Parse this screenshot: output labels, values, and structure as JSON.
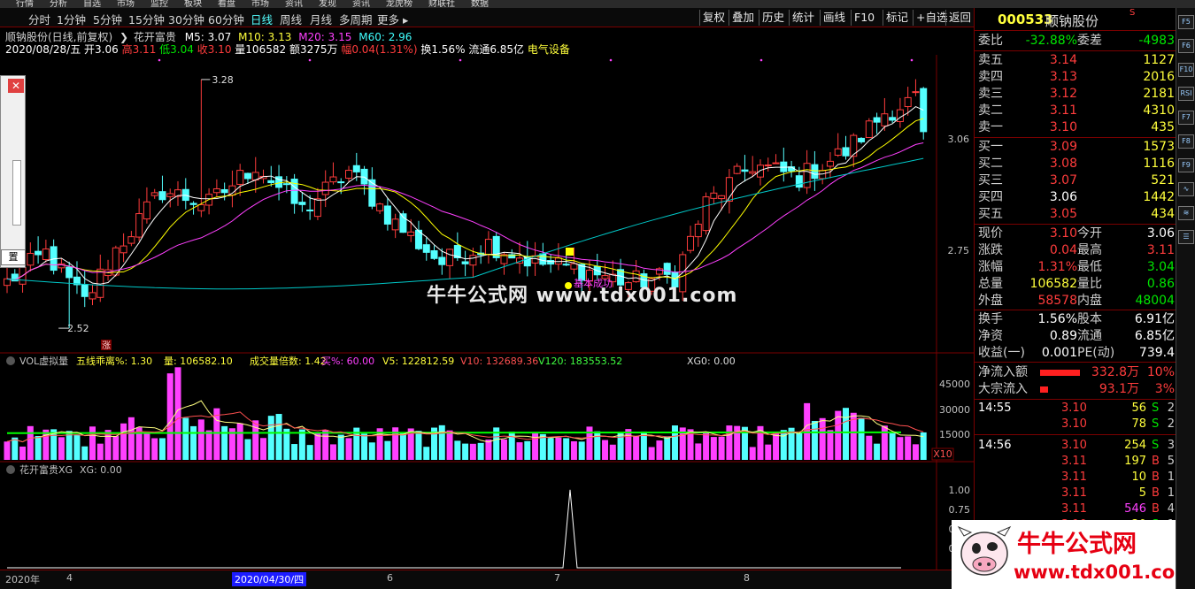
{
  "top_menu": [
    "行情",
    "分析",
    "自选",
    "市场",
    "监控",
    "板块",
    "看盘",
    "市场",
    "资讯",
    "发现",
    "资讯",
    "龙虎榜",
    "财联社",
    "数据"
  ],
  "toolbar": {
    "periods": [
      "分时",
      "1分钟",
      "5分钟",
      "15分钟",
      "30分钟",
      "60分钟",
      "日线",
      "周线",
      "月线",
      "多周期",
      "更多 ▸"
    ],
    "selected": "日线",
    "right_buttons": [
      "复权",
      "叠加",
      "历史",
      "统计",
      "画线",
      "F10",
      "标记",
      "+自选",
      "返回"
    ]
  },
  "chart_header": {
    "name": "顺钠股份(日线,前复权)",
    "indicator": "花开富贵",
    "m5": "M5: 3.07",
    "m10": "M10: 3.13",
    "m20": "M20: 3.15",
    "m60": "M60: 2.96",
    "date": "2020/08/28/五",
    "open": "开3.06",
    "high": "高3.11",
    "low": "低3.04",
    "close": "收3.10",
    "vol": "量106582",
    "amt": "额3275万",
    "chg": "幅0.04(1.31%)",
    "turn": "换1.56%",
    "float": "流通6.85亿",
    "sector": "电气设备"
  },
  "price_labels": {
    "high": "3.28",
    "low": "2.52",
    "mark": "涨",
    "success": "基本成功",
    "axis": [
      "3.06",
      "2.75"
    ]
  },
  "watermark": "牛牛公式网 www.tdx001.com",
  "vol_header": {
    "name": "VOL虚拟量",
    "wx": "五线乖离%: 1.30",
    "liang": "量: 106582.10",
    "bei": "成交量倍数: 1.42",
    "mai": "买%: 60.00",
    "v5": "V5: 122812.59",
    "v10": "V10: 132689.36",
    "v120": "V120: 183553.52",
    "xg0": "XG0: 0.00",
    "axis": [
      "45000",
      "30000",
      "15000"
    ],
    "x10": "X10"
  },
  "xg_header": {
    "name": "花开富贵XG",
    "val": "XG: 0.00",
    "axis": [
      "1.00",
      "0.75",
      "0.50",
      "0.25"
    ]
  },
  "x_axis": [
    "2020年",
    "4",
    "2020/04/30/四",
    "6",
    "7",
    "8"
  ],
  "stock": {
    "code": "000533",
    "name": "顺钠股份",
    "flag": "S"
  },
  "weibi": {
    "label": "委比",
    "value": "-32.88%",
    "label2": "委差",
    "value2": "-4983"
  },
  "asks": [
    {
      "label": "卖五",
      "price": "3.14",
      "vol": "1127"
    },
    {
      "label": "卖四",
      "price": "3.13",
      "vol": "2016"
    },
    {
      "label": "卖三",
      "price": "3.12",
      "vol": "2181"
    },
    {
      "label": "卖二",
      "price": "3.11",
      "vol": "4310"
    },
    {
      "label": "卖一",
      "price": "3.10",
      "vol": "435"
    }
  ],
  "bids": [
    {
      "label": "买一",
      "price": "3.09",
      "vol": "1573"
    },
    {
      "label": "买二",
      "price": "3.08",
      "vol": "1116"
    },
    {
      "label": "买三",
      "price": "3.07",
      "vol": "521"
    },
    {
      "label": "买四",
      "price": "3.06",
      "vol": "1442"
    },
    {
      "label": "买五",
      "price": "3.05",
      "vol": "434"
    }
  ],
  "quote": [
    {
      "l1": "现价",
      "v1": "3.10",
      "c1": "red",
      "l2": "今开",
      "v2": "3.06",
      "c2": "wht"
    },
    {
      "l1": "涨跌",
      "v1": "0.04",
      "c1": "red",
      "l2": "最高",
      "v2": "3.11",
      "c2": "red"
    },
    {
      "l1": "涨幅",
      "v1": "1.31%",
      "c1": "red",
      "l2": "最低",
      "v2": "3.04",
      "c2": "grn"
    },
    {
      "l1": "总量",
      "v1": "106582",
      "c1": "yel",
      "l2": "量比",
      "v2": "0.86",
      "c2": "grn"
    },
    {
      "l1": "外盘",
      "v1": "58578",
      "c1": "red",
      "l2": "内盘",
      "v2": "48004",
      "c2": "grn"
    }
  ],
  "fund": [
    {
      "l1": "换手",
      "v1": "1.56%",
      "l2": "股本",
      "v2": "6.91亿"
    },
    {
      "l1": "净资",
      "v1": "0.89",
      "l2": "流通",
      "v2": "6.85亿"
    },
    {
      "l1": "收益(一)",
      "v1": "0.001",
      "l2": "PE(动)",
      "v2": "739.4"
    }
  ],
  "flow": [
    {
      "label": "净流入额",
      "amount": "332.8万",
      "pct": "10%",
      "bar": 0.9
    },
    {
      "label": "大宗流入",
      "amount": "93.1万",
      "pct": "3%",
      "bar": 0.18
    }
  ],
  "ticks": [
    {
      "t": "14:55",
      "p": "3.10",
      "q": "56",
      "s": "S",
      "n": "2"
    },
    {
      "t": "",
      "p": "3.10",
      "q": "78",
      "s": "S",
      "n": "2"
    },
    {
      "t": "14:56",
      "p": "3.10",
      "q": "254",
      "s": "S",
      "n": "3"
    },
    {
      "t": "",
      "p": "3.11",
      "q": "197",
      "s": "B",
      "n": "5"
    },
    {
      "t": "",
      "p": "3.11",
      "q": "10",
      "s": "B",
      "n": "1"
    },
    {
      "t": "",
      "p": "3.11",
      "q": "5",
      "s": "B",
      "n": "1"
    },
    {
      "t": "",
      "p": "3.11",
      "q": "546",
      "s": "B",
      "n": "4"
    },
    {
      "t": "",
      "p": "3.10",
      "q": "20",
      "s": "S",
      "n": "1"
    }
  ],
  "right_icons": [
    "F5",
    "F6",
    "F10",
    "RSI",
    "F7",
    "F8",
    "F9",
    "∿",
    "≋",
    "☰"
  ],
  "logo": {
    "title": "牛牛公式网",
    "url": "www.tdx001.com"
  },
  "colors": {
    "up": "#ff3c3c",
    "down": "#54ffff",
    "ma5": "#ffffff",
    "ma10": "#ffff00",
    "ma20": "#ff40ff",
    "ma60": "#00c8c8",
    "vol_up": "#ff40ff",
    "vol_down": "#54ffff",
    "baseline": "#00ff00"
  }
}
